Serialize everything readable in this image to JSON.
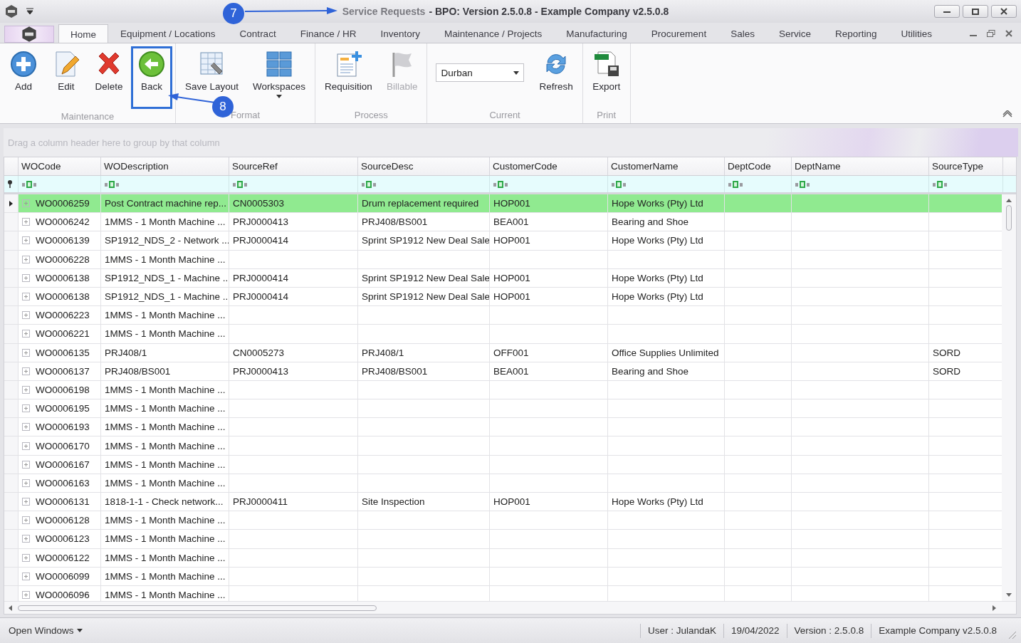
{
  "window": {
    "document": "Service Requests",
    "title": "- BPO: Version 2.5.0.8 - Example Company v2.5.0.8"
  },
  "tabs": [
    {
      "label": "Home",
      "selected": true
    },
    {
      "label": "Equipment / Locations",
      "selected": false
    },
    {
      "label": "Contract",
      "selected": false
    },
    {
      "label": "Finance / HR",
      "selected": false
    },
    {
      "label": "Inventory",
      "selected": false
    },
    {
      "label": "Maintenance / Projects",
      "selected": false
    },
    {
      "label": "Manufacturing",
      "selected": false
    },
    {
      "label": "Procurement",
      "selected": false
    },
    {
      "label": "Sales",
      "selected": false
    },
    {
      "label": "Service",
      "selected": false
    },
    {
      "label": "Reporting",
      "selected": false
    },
    {
      "label": "Utilities",
      "selected": false
    }
  ],
  "ribbon": {
    "groups": [
      {
        "label": "Maintenance",
        "items": [
          {
            "kind": "button",
            "label": "Add",
            "disabled": false
          },
          {
            "kind": "button",
            "label": "Edit",
            "disabled": false
          },
          {
            "kind": "button",
            "label": "Delete",
            "disabled": false
          },
          {
            "kind": "button",
            "label": "Back",
            "disabled": false,
            "highlighted": true
          }
        ]
      },
      {
        "label": "Format",
        "items": [
          {
            "kind": "button",
            "label": "Save Layout",
            "disabled": false
          },
          {
            "kind": "menu",
            "label": "Workspaces",
            "disabled": false
          }
        ]
      },
      {
        "label": "Process",
        "items": [
          {
            "kind": "button",
            "label": "Requisition",
            "disabled": false
          },
          {
            "kind": "button",
            "label": "Billable",
            "disabled": true
          }
        ]
      },
      {
        "label": "Current",
        "items": [
          {
            "kind": "dropdown",
            "value": "Durban"
          },
          {
            "kind": "button",
            "label": "Refresh",
            "disabled": false
          }
        ]
      },
      {
        "label": "Print",
        "items": [
          {
            "kind": "button",
            "label": "Export",
            "disabled": false
          }
        ]
      }
    ]
  },
  "annotations": [
    {
      "label": "7"
    },
    {
      "label": "8"
    }
  ],
  "group_panel": {
    "placeholder": "Drag a column header here to group by that column"
  },
  "table": {
    "columns": [
      "WOCode",
      "WODescription",
      "SourceRef",
      "SourceDesc",
      "CustomerCode",
      "CustomerName",
      "DeptCode",
      "DeptName",
      "SourceType"
    ],
    "rows": [
      {
        "selected": true,
        "cells": [
          "WO0006259",
          "Post Contract machine rep...",
          "CN0005303",
          "Drum replacement required",
          "HOP001",
          "Hope Works (Pty) Ltd",
          null,
          null,
          null
        ]
      },
      {
        "selected": false,
        "cells": [
          "WO0006242",
          "1MMS - 1 Month Machine ...",
          "PRJ0000413",
          "PRJ408/BS001",
          "BEA001",
          "Bearing and Shoe",
          null,
          null,
          null
        ]
      },
      {
        "selected": false,
        "cells": [
          "WO0006139",
          "SP1912_NDS_2 - Network ...",
          "PRJ0000414",
          "Sprint SP1912 New Deal Sale",
          "HOP001",
          "Hope Works (Pty) Ltd",
          null,
          null,
          null
        ]
      },
      {
        "selected": false,
        "cells": [
          "WO0006228",
          "1MMS - 1 Month Machine ...",
          null,
          null,
          null,
          null,
          null,
          null,
          null
        ]
      },
      {
        "selected": false,
        "cells": [
          "WO0006138",
          "SP1912_NDS_1 - Machine ...",
          "PRJ0000414",
          "Sprint SP1912 New Deal Sale",
          "HOP001",
          "Hope Works (Pty) Ltd",
          null,
          null,
          null
        ]
      },
      {
        "selected": false,
        "cells": [
          "WO0006138",
          "SP1912_NDS_1 - Machine ...",
          "PRJ0000414",
          "Sprint SP1912 New Deal Sale",
          "HOP001",
          "Hope Works (Pty) Ltd",
          null,
          null,
          null
        ]
      },
      {
        "selected": false,
        "cells": [
          "WO0006223",
          "1MMS - 1 Month Machine ...",
          null,
          null,
          null,
          null,
          null,
          null,
          null
        ]
      },
      {
        "selected": false,
        "cells": [
          "WO0006221",
          "1MMS - 1 Month Machine ...",
          null,
          null,
          null,
          null,
          null,
          null,
          null
        ]
      },
      {
        "selected": false,
        "cells": [
          "WO0006135",
          "PRJ408/1",
          "CN0005273",
          "PRJ408/1",
          "OFF001",
          "Office Supplies Unlimited",
          null,
          null,
          "SORD"
        ]
      },
      {
        "selected": false,
        "cells": [
          "WO0006137",
          "PRJ408/BS001",
          "PRJ0000413",
          "PRJ408/BS001",
          "BEA001",
          "Bearing and Shoe",
          null,
          null,
          "SORD"
        ]
      },
      {
        "selected": false,
        "cells": [
          "WO0006198",
          "1MMS - 1 Month Machine ...",
          null,
          null,
          null,
          null,
          null,
          null,
          null
        ]
      },
      {
        "selected": false,
        "cells": [
          "WO0006195",
          "1MMS - 1 Month Machine ...",
          null,
          null,
          null,
          null,
          null,
          null,
          null
        ]
      },
      {
        "selected": false,
        "cells": [
          "WO0006193",
          "1MMS - 1 Month Machine ...",
          null,
          null,
          null,
          null,
          null,
          null,
          null
        ]
      },
      {
        "selected": false,
        "cells": [
          "WO0006170",
          "1MMS - 1 Month Machine ...",
          null,
          null,
          null,
          null,
          null,
          null,
          null
        ]
      },
      {
        "selected": false,
        "cells": [
          "WO0006167",
          "1MMS - 1 Month Machine ...",
          null,
          null,
          null,
          null,
          null,
          null,
          null
        ]
      },
      {
        "selected": false,
        "cells": [
          "WO0006163",
          "1MMS - 1 Month Machine ...",
          null,
          null,
          null,
          null,
          null,
          null,
          null
        ]
      },
      {
        "selected": false,
        "cells": [
          "WO0006131",
          "1818-1-1 - Check network...",
          "PRJ0000411",
          "Site Inspection",
          "HOP001",
          "Hope Works (Pty) Ltd",
          null,
          null,
          null
        ]
      },
      {
        "selected": false,
        "cells": [
          "WO0006128",
          "1MMS - 1 Month Machine ...",
          null,
          null,
          null,
          null,
          null,
          null,
          null
        ]
      },
      {
        "selected": false,
        "cells": [
          "WO0006123",
          "1MMS - 1 Month Machine ...",
          null,
          null,
          null,
          null,
          null,
          null,
          null
        ]
      },
      {
        "selected": false,
        "cells": [
          "WO0006122",
          "1MMS - 1 Month Machine ...",
          null,
          null,
          null,
          null,
          null,
          null,
          null
        ]
      },
      {
        "selected": false,
        "cells": [
          "WO0006099",
          "1MMS - 1 Month Machine ...",
          null,
          null,
          null,
          null,
          null,
          null,
          null
        ]
      },
      {
        "selected": false,
        "cells": [
          "WO0006096",
          "1MMS - 1 Month Machine ...",
          null,
          null,
          null,
          null,
          null,
          null,
          null
        ]
      }
    ]
  },
  "status_bar": {
    "menu": "Open Windows",
    "items": [
      "User : JulandaK",
      "19/04/2022",
      "Version : 2.5.0.8",
      "Example Company v2.5.0.8"
    ]
  }
}
